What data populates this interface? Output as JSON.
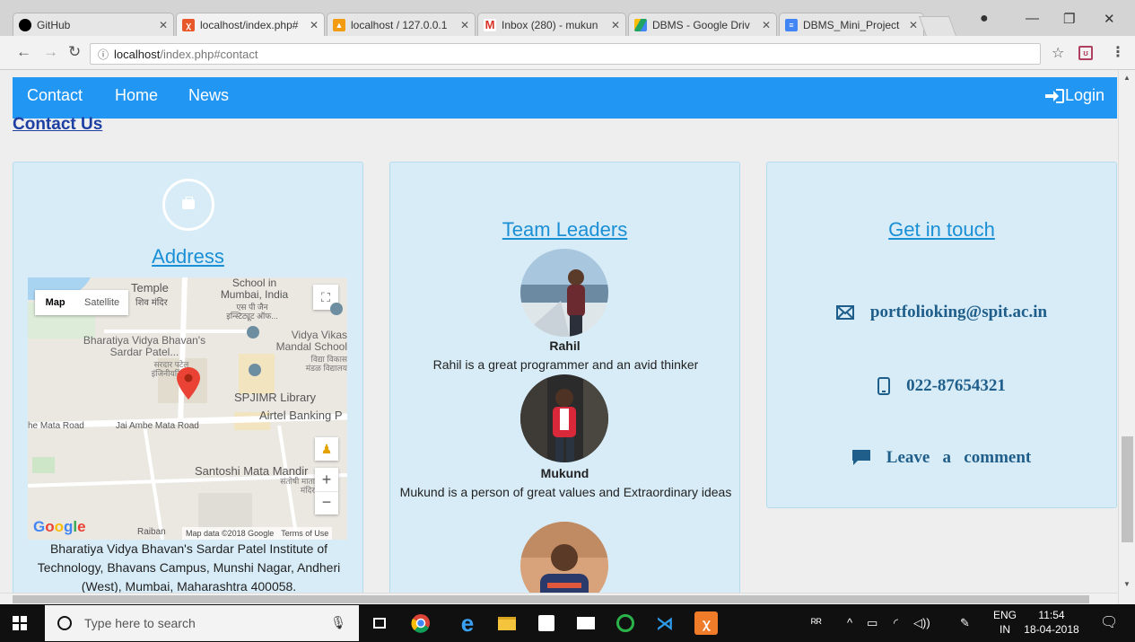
{
  "browser": {
    "tabs": [
      {
        "label": "GitHub",
        "icon": "github-icon",
        "color": "#000000"
      },
      {
        "label": "localhost/index.php#",
        "icon": "xampp-icon",
        "color": "#e8572a"
      },
      {
        "label": "localhost / 127.0.0.1",
        "icon": "phpmyadmin-icon",
        "color": "#f39c12"
      },
      {
        "label": "Inbox (280) - mukun",
        "icon": "gmail-icon",
        "color": "#d93025"
      },
      {
        "label": "DBMS - Google Driv",
        "icon": "google-drive-icon",
        "color": "#1fa463"
      },
      {
        "label": "DBMS_Mini_Project",
        "icon": "google-docs-icon",
        "color": "#4285f4"
      }
    ],
    "url_host": "localhost",
    "url_path": "/index.php#contact"
  },
  "nav": {
    "links": [
      "Contact",
      "Home",
      "News"
    ],
    "login": "Login",
    "color": "#2196f3"
  },
  "page": {
    "contact_title": "Contact Us",
    "address": {
      "title": "Address",
      "text": "Bharatiya Vidya Bhavan's Sardar Patel Institute of Technology, Bhavans Campus, Munshi Nagar, Andheri (West), Mumbai, Maharashtra 400058.",
      "map": {
        "type_map": "Map",
        "type_satellite": "Satellite",
        "labels": {
          "temple": "Temple",
          "temple_hi": "शिव मंदिर",
          "school": "School in Mumbai, India",
          "school_hi": "एस पी जैन इन्स्टिट्यूट ऑफ...",
          "vidya": "Vidya Vikas Mandal School",
          "vidya_hi": "विद्या विकास मंडळ विद्यालय",
          "bhavan": "Bharatiya Vidya Bhavan's Sardar Patel...",
          "bhavan_hi": "सरदार पटेल इंजिनीयरिंग...",
          "spjimr": "SPJIMR Library",
          "airtel": "Airtel Banking P",
          "mata_road": "he Mata Road",
          "jai_ambe": "Jai Ambe Mata Road",
          "santoshi": "Santoshi Mata Mandir",
          "santoshi_hi": "संतोषी माता मंदिर",
          "raiban": "Raiban"
        },
        "attribution": "Map data ©2018 Google",
        "terms": "Terms of Use",
        "logo": "Google"
      }
    },
    "team": {
      "title": "Team Leaders",
      "members": [
        {
          "name": "Rahil",
          "desc": "Rahil is a great programmer and an avid thinker"
        },
        {
          "name": "Mukund",
          "desc": "Mukund is a person of great values and Extraordinary ideas"
        }
      ]
    },
    "touch": {
      "title": "Get in touch",
      "email": "portfolioking@spit.ac.in",
      "phone": "022-87654321",
      "comment": "Leave   a   comment"
    }
  },
  "taskbar": {
    "search_placeholder": "Type here to search",
    "lang_top": "ENG",
    "lang_bottom": "IN",
    "time": "11:54",
    "date": "18-04-2018"
  }
}
